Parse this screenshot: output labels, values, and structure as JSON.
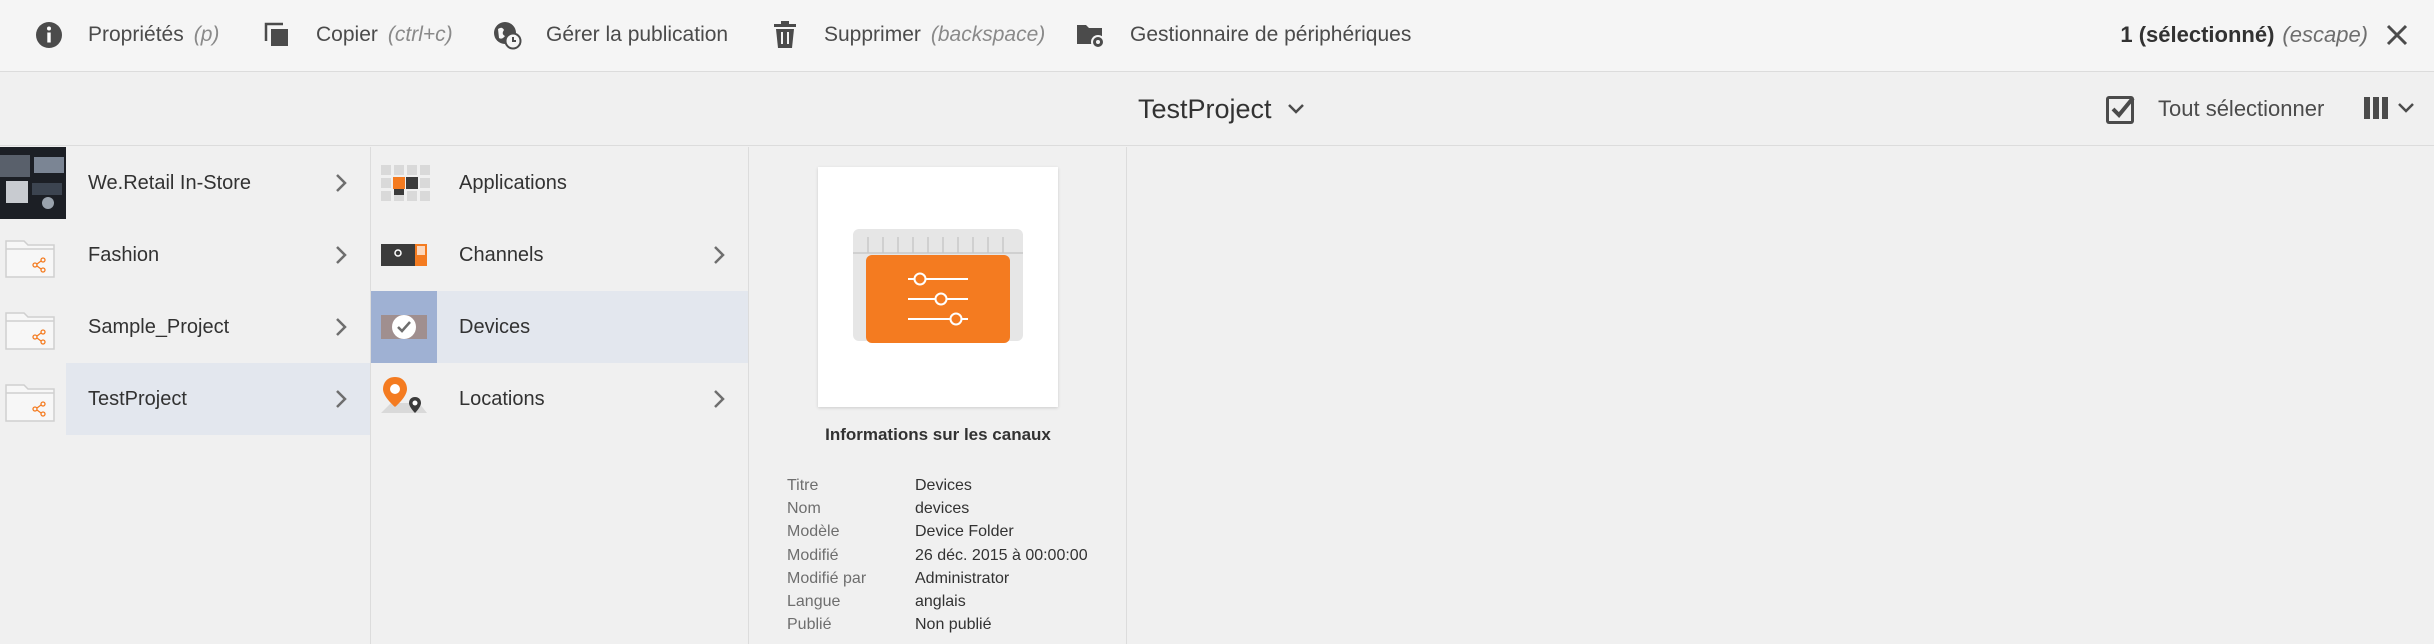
{
  "actionbar": {
    "properties": {
      "label": "Propriétés",
      "hint": "(p)",
      "icon": "info-icon"
    },
    "copy": {
      "label": "Copier",
      "hint": "(ctrl+c)",
      "icon": "copy-icon"
    },
    "publication": {
      "label": "Gérer la publication",
      "icon": "globe-clock-icon"
    },
    "delete": {
      "label": "Supprimer",
      "hint": "(backspace)",
      "icon": "trash-icon"
    },
    "device_manager": {
      "label": "Gestionnaire de périphériques",
      "icon": "folder-gear-icon"
    },
    "selection": {
      "count": "1 (sélectionné)",
      "hint": "(escape)"
    }
  },
  "titlebar": {
    "title": "TestProject",
    "select_all": "Tout sélectionner"
  },
  "columns": {
    "col1": [
      {
        "label": "We.Retail In-Store",
        "has_children": true
      },
      {
        "label": "Fashion",
        "has_children": true
      },
      {
        "label": "Sample_Project",
        "has_children": true
      },
      {
        "label": "TestProject",
        "has_children": true,
        "active": true
      }
    ],
    "col2": [
      {
        "label": "Applications",
        "has_children": false
      },
      {
        "label": "Channels",
        "has_children": true
      },
      {
        "label": "Devices",
        "has_children": false,
        "selected": true
      },
      {
        "label": "Locations",
        "has_children": true
      }
    ]
  },
  "preview": {
    "title": "Informations sur les canaux",
    "meta": [
      {
        "key": "Titre",
        "value": "Devices"
      },
      {
        "key": "Nom",
        "value": "devices"
      },
      {
        "key": "Modèle",
        "value": "Device Folder"
      },
      {
        "key": "Modifié",
        "value": "26 déc. 2015 à 00:00:00"
      },
      {
        "key": "Modifié par",
        "value": "Administrator"
      },
      {
        "key": "Langue",
        "value": "anglais"
      },
      {
        "key": "Publié",
        "value": "Non publié"
      }
    ]
  },
  "colors": {
    "accent_orange": "#f47b20",
    "selected_row": "#e3e7ee",
    "selected_thumb": "#9fb1d3"
  }
}
